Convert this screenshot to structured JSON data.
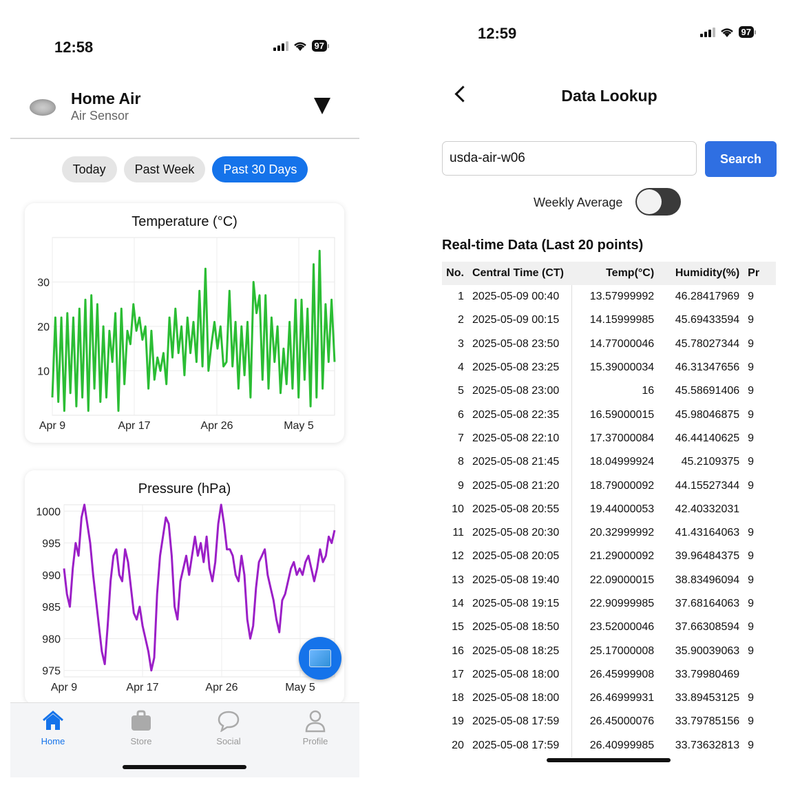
{
  "left": {
    "status": {
      "time": "12:58",
      "battery": "97"
    },
    "device": {
      "title": "Home Air",
      "subtitle": "Air Sensor"
    },
    "range_tabs": [
      {
        "label": "Today",
        "active": false
      },
      {
        "label": "Past Week",
        "active": false
      },
      {
        "label": "Past 30 Days",
        "active": true
      }
    ],
    "tab_bar": [
      {
        "label": "Home",
        "icon": "home-icon",
        "active": true
      },
      {
        "label": "Store",
        "icon": "bag-icon",
        "active": false
      },
      {
        "label": "Social",
        "icon": "chat-icon",
        "active": false
      },
      {
        "label": "Profile",
        "icon": "person-icon",
        "active": false
      }
    ]
  },
  "right": {
    "status": {
      "time": "12:59",
      "battery": "97"
    },
    "nav": {
      "title": "Data Lookup"
    },
    "search": {
      "value": "usda-air-w06",
      "button": "Search"
    },
    "toggle": {
      "label": "Weekly Average",
      "on": false
    },
    "section_title": "Real-time Data (Last 20 points)",
    "table": {
      "headers": [
        "No.",
        "Central Time (CT)",
        "Temp(°C)",
        "Humidity(%)",
        "Pr"
      ],
      "rows": [
        [
          "1",
          "2025-05-09 00:40",
          "13.57999992",
          "46.28417969",
          "9"
        ],
        [
          "2",
          "2025-05-09 00:15",
          "14.15999985",
          "45.69433594",
          "9"
        ],
        [
          "3",
          "2025-05-08 23:50",
          "14.77000046",
          "45.78027344",
          "9"
        ],
        [
          "4",
          "2025-05-08 23:25",
          "15.39000034",
          "46.31347656",
          "9"
        ],
        [
          "5",
          "2025-05-08 23:00",
          "16",
          "45.58691406",
          "9"
        ],
        [
          "6",
          "2025-05-08 22:35",
          "16.59000015",
          "45.98046875",
          "9"
        ],
        [
          "7",
          "2025-05-08 22:10",
          "17.37000084",
          "46.44140625",
          "9"
        ],
        [
          "8",
          "2025-05-08 21:45",
          "18.04999924",
          "45.2109375",
          "9"
        ],
        [
          "9",
          "2025-05-08 21:20",
          "18.79000092",
          "44.15527344",
          "9"
        ],
        [
          "10",
          "2025-05-08 20:55",
          "19.44000053",
          "42.40332031",
          ""
        ],
        [
          "11",
          "2025-05-08 20:30",
          "20.32999992",
          "41.43164063",
          "9"
        ],
        [
          "12",
          "2025-05-08 20:05",
          "21.29000092",
          "39.96484375",
          "9"
        ],
        [
          "13",
          "2025-05-08 19:40",
          "22.09000015",
          "38.83496094",
          "9"
        ],
        [
          "14",
          "2025-05-08 19:15",
          "22.90999985",
          "37.68164063",
          "9"
        ],
        [
          "15",
          "2025-05-08 18:50",
          "23.52000046",
          "37.66308594",
          "9"
        ],
        [
          "16",
          "2025-05-08 18:25",
          "25.17000008",
          "35.90039063",
          "9"
        ],
        [
          "17",
          "2025-05-08 18:00",
          "26.45999908",
          "33.79980469",
          ""
        ],
        [
          "18",
          "2025-05-08 18:00",
          "26.46999931",
          "33.89453125",
          "9"
        ],
        [
          "19",
          "2025-05-08 17:59",
          "26.45000076",
          "33.79785156",
          "9"
        ],
        [
          "20",
          "2025-05-08 17:59",
          "26.40999985",
          "33.73632813",
          "9"
        ]
      ]
    }
  },
  "colors": {
    "accent": "#1573ea",
    "temperature_line": "#2bbd34",
    "pressure_line": "#9b1fc7",
    "search_button": "#2f6fe2"
  },
  "chart_data": [
    {
      "type": "line",
      "title": "Temperature (°C)",
      "x_ticks": [
        "Apr 9",
        "Apr 17",
        "Apr 26",
        "May 5"
      ],
      "y_ticks": [
        10,
        20,
        30
      ],
      "ylim": [
        0,
        40
      ],
      "series": [
        {
          "values": [
            4,
            22,
            3,
            22,
            1,
            23,
            5,
            22,
            2,
            24,
            4,
            26,
            1,
            27,
            6,
            25,
            3,
            20,
            4,
            19,
            12,
            23,
            1,
            24,
            7,
            19,
            16,
            25,
            19,
            22,
            17,
            20,
            6,
            19,
            8,
            13,
            10,
            14,
            7,
            22,
            13,
            24,
            14,
            20,
            9,
            22,
            14,
            21,
            12,
            28,
            11,
            33,
            10,
            16,
            21,
            15,
            20,
            11,
            12,
            28,
            11,
            21,
            6,
            20,
            9,
            21,
            4,
            30,
            23,
            27,
            8,
            27,
            6,
            22,
            12,
            20,
            5,
            15,
            7,
            21,
            6,
            26,
            4,
            26,
            8,
            24,
            2,
            34,
            4,
            37,
            6,
            25,
            12,
            26,
            12
          ]
        }
      ]
    },
    {
      "type": "line",
      "title": "Pressure (hPa)",
      "x_ticks": [
        "Apr 9",
        "Apr 17",
        "Apr 26",
        "May 5"
      ],
      "y_ticks": [
        975,
        980,
        985,
        990,
        995,
        1000
      ],
      "ylim": [
        974,
        1001
      ],
      "series": [
        {
          "values": [
            991,
            987,
            985,
            991,
            995,
            993,
            999,
            1001,
            998,
            995,
            990,
            986,
            982,
            978,
            976,
            982,
            989,
            993,
            994,
            990,
            989,
            994,
            992,
            988,
            984,
            983,
            985,
            982,
            980,
            978,
            975,
            977,
            987,
            993,
            996,
            999,
            998,
            993,
            985,
            983,
            989,
            991,
            993,
            990,
            993,
            996,
            993,
            995,
            992,
            996,
            991,
            989,
            992,
            998,
            1001,
            998,
            994,
            994,
            993,
            990,
            989,
            993,
            990,
            983,
            980,
            982,
            988,
            992,
            993,
            994,
            990,
            988,
            986,
            983,
            981,
            986,
            987,
            989,
            991,
            992,
            990,
            991,
            990,
            992,
            993,
            991,
            989,
            991,
            994,
            992,
            993,
            996,
            995,
            997
          ]
        }
      ]
    }
  ]
}
